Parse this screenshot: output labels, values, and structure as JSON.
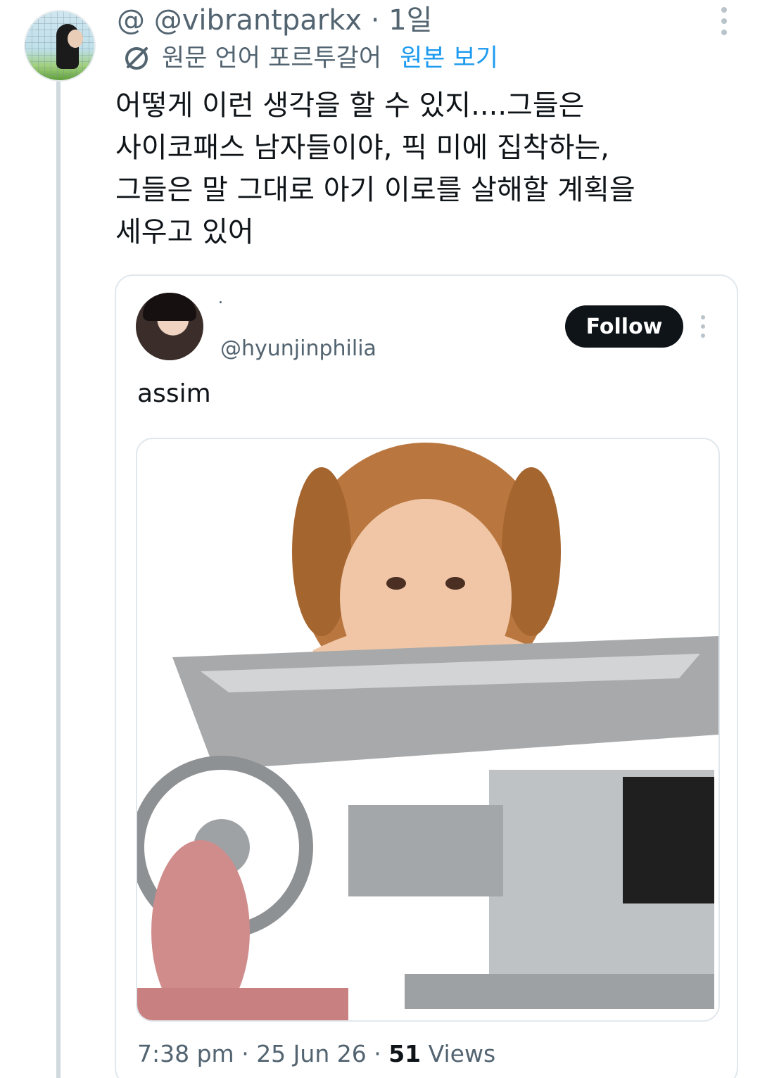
{
  "tweet": {
    "prefix": "@",
    "handle": "@vibrantparkx",
    "separator": " · ",
    "time": "1일",
    "translation": {
      "label": "원문 언어 포르투갈어",
      "link": "원본 보기"
    },
    "text_lines": [
      "어떻게 이런 생각을 할 수 있지....그들은",
      "사이코패스 남자들이야, 픽 미에 집착하는,",
      "그들은 말 그대로 아기 이로를 살해할 계획을",
      "세우고 있어"
    ]
  },
  "quoted_tweet": {
    "handle": "@hyunjinphilia",
    "follow_label": "Follow",
    "text": "assim",
    "meta": {
      "time": "7:38 pm",
      "dot1": " · ",
      "date": "25 Jun 26",
      "dot2": " · ",
      "views_count": "51",
      "views_label": " Views"
    }
  },
  "colors": {
    "muted": "#536471",
    "link": "#1d9bf0",
    "text": "#0f1419",
    "follow_bg": "#0f1419"
  }
}
